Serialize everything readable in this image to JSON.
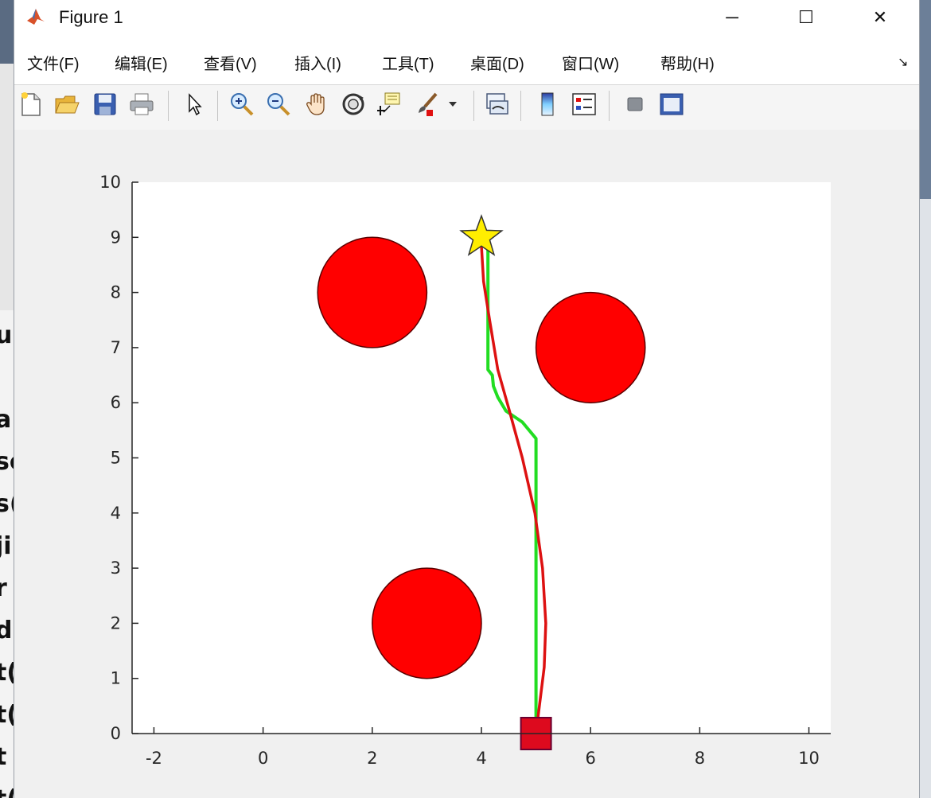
{
  "window": {
    "title": "Figure 1",
    "controls": {
      "minimize": "─",
      "maximize": "☐",
      "close": "✕"
    }
  },
  "menu": {
    "items": [
      "文件(F)",
      "编辑(E)",
      "查看(V)",
      "插入(I)",
      "工具(T)",
      "桌面(D)",
      "窗口(W)",
      "帮助(H)"
    ],
    "dock_arrow": "↘"
  },
  "toolbar": {
    "icons": [
      "new-figure-icon",
      "open-file-icon",
      "save-icon",
      "print-icon",
      "edit-plot-arrow-icon",
      "zoom-in-icon",
      "zoom-out-icon",
      "pan-hand-icon",
      "rotate-3d-icon",
      "data-cursor-icon",
      "brush-icon",
      "brush-dropdown-icon",
      "link-plot-icon",
      "colorbar-icon",
      "legend-icon",
      "hide-plot-tools-icon",
      "show-plot-tools-icon"
    ]
  },
  "background": {
    "code_fragments": [
      "u",
      "",
      "a",
      "se",
      "s(",
      "ji",
      "r",
      "d",
      "t(",
      "t(",
      "t",
      "t("
    ]
  },
  "colors": {
    "obstacle": "#ff0000",
    "green_path": "#22dd22",
    "red_path": "#dd1111",
    "goal_star": "#ffee00",
    "start_square": "#dd0a1e"
  },
  "chart_data": {
    "type": "scatter",
    "title": "",
    "xlabel": "",
    "ylabel": "",
    "xlim": [
      -2.4,
      10.4
    ],
    "ylim": [
      0,
      10
    ],
    "xticks": [
      -2,
      0,
      2,
      4,
      6,
      8,
      10
    ],
    "yticks": [
      0,
      1,
      2,
      3,
      4,
      5,
      6,
      7,
      8,
      9,
      10
    ],
    "obstacles": [
      {
        "cx": 2,
        "cy": 8,
        "r": 1
      },
      {
        "cx": 6,
        "cy": 7,
        "r": 1
      },
      {
        "cx": 3,
        "cy": 2,
        "r": 1
      }
    ],
    "start": {
      "x": 5,
      "y": 0,
      "marker": "square"
    },
    "goal": {
      "x": 4,
      "y": 9,
      "marker": "star"
    },
    "series": [
      {
        "values": [
          [
            5.0,
            0.1
          ],
          [
            5.0,
            5.35
          ],
          [
            4.75,
            5.65
          ],
          [
            4.45,
            5.85
          ],
          [
            4.3,
            6.1
          ],
          [
            4.22,
            6.3
          ],
          [
            4.2,
            6.5
          ],
          [
            4.12,
            6.6
          ],
          [
            4.12,
            8.8
          ],
          [
            4.05,
            8.95
          ]
        ]
      },
      {
        "values": [
          [
            5.0,
            0.0
          ],
          [
            5.05,
            0.4
          ],
          [
            5.15,
            1.2
          ],
          [
            5.18,
            2.0
          ],
          [
            5.12,
            3.0
          ],
          [
            4.98,
            4.0
          ],
          [
            4.75,
            5.0
          ],
          [
            4.5,
            5.9
          ],
          [
            4.3,
            6.6
          ],
          [
            4.15,
            7.5
          ],
          [
            4.04,
            8.2
          ],
          [
            4.0,
            8.85
          ]
        ]
      }
    ]
  }
}
